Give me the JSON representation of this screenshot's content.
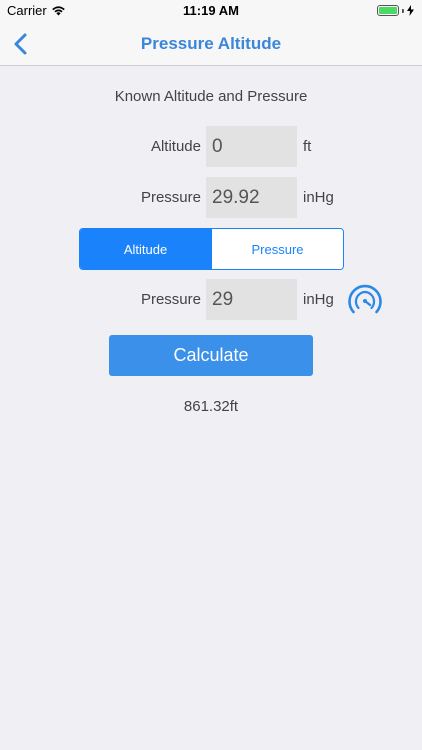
{
  "status_bar": {
    "carrier": "Carrier",
    "time": "11:19 AM",
    "battery_color": "#4cd964"
  },
  "nav": {
    "title": "Pressure Altitude",
    "back_icon": "chevron-left-icon",
    "accent_color": "#3b86d9"
  },
  "known_section": {
    "title": "Known Altitude and Pressure",
    "altitude": {
      "label": "Altitude",
      "value": "0",
      "unit": "ft"
    },
    "pressure": {
      "label": "Pressure",
      "value": "29.92",
      "unit": "inHg"
    }
  },
  "mode_segment": {
    "options": [
      "Altitude",
      "Pressure"
    ],
    "selected": "Altitude",
    "accent_color": "#1a82fb"
  },
  "target": {
    "label": "Pressure",
    "value": "29",
    "unit": "inHg",
    "icon": "gauge-icon"
  },
  "calculate_button": {
    "label": "Calculate",
    "color": "#3b90ea"
  },
  "result": {
    "text": "861.32ft"
  }
}
